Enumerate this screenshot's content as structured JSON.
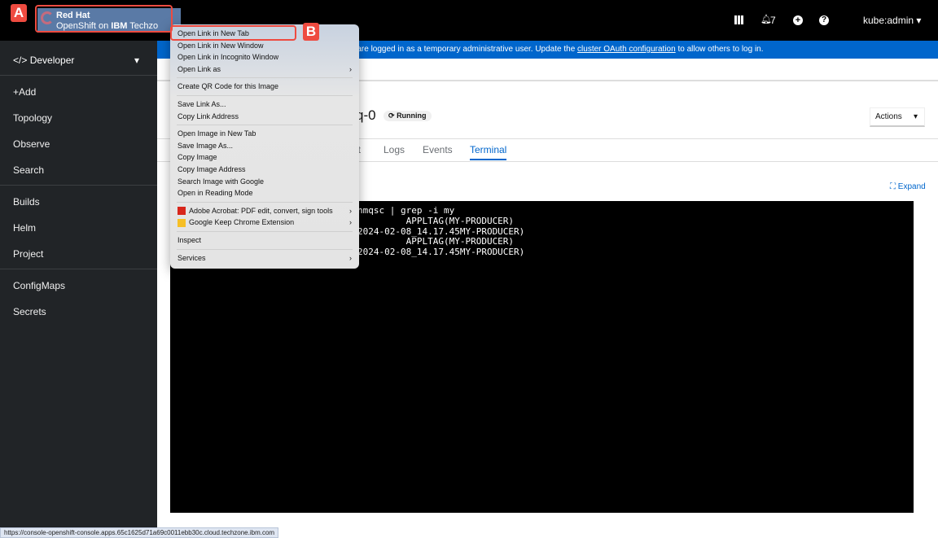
{
  "brand": {
    "line1": "Red Hat",
    "line2_prefix": "OpenShift on ",
    "line2_bold": "IBM",
    "line2_suffix": " Techzo"
  },
  "topbar": {
    "notifications": "7",
    "user": "kube:admin"
  },
  "sidebar": {
    "perspective": "Developer",
    "items": [
      "+Add",
      "Topology",
      "Observe",
      "Search",
      "Builds",
      "Helm",
      "Project",
      "ConfigMaps",
      "Secrets"
    ]
  },
  "banner": {
    "text": "u are logged in as a temporary administrative user. Update the ",
    "link": "cluster OAuth configuration",
    "suffix": " to allow others to log in."
  },
  "page": {
    "title_fragment": "q-0",
    "status": "Running",
    "actions": "Actions",
    "tabs": [
      "nt",
      "Logs",
      "Events",
      "Terminal"
    ],
    "active_tab": "Terminal",
    "expand": "Expand"
  },
  "terminal": {
    "lines": [
      "nmqsc | grep -i my",
      "         APPLTAG(MY-PRODUCER)",
      "2024-02-08_14.17.45MY-PRODUCER)",
      "         APPLTAG(MY-PRODUCER)",
      "2024-02-08_14.17.45MY-PRODUCER)"
    ]
  },
  "context_menu": {
    "items": [
      "Open Link in New Tab",
      "Open Link in New Window",
      "Open Link in Incognito Window",
      "Open Link as",
      "Create QR Code for this Image",
      "Save Link As...",
      "Copy Link Address",
      "Open Image in New Tab",
      "Save Image As...",
      "Copy Image",
      "Copy Image Address",
      "Search Image with Google",
      "Open in Reading Mode",
      "Adobe Acrobat: PDF edit, convert, sign tools",
      "Google Keep Chrome Extension",
      "Inspect",
      "Services"
    ]
  },
  "annotations": {
    "a": "A",
    "b": "B"
  },
  "status_url": "https://console-openshift-console.apps.65c1625d71a69c0011ebb30c.cloud.techzone.ibm.com",
  "colors": {
    "accent": "#0066cc",
    "highlight": "#ee4b40"
  }
}
